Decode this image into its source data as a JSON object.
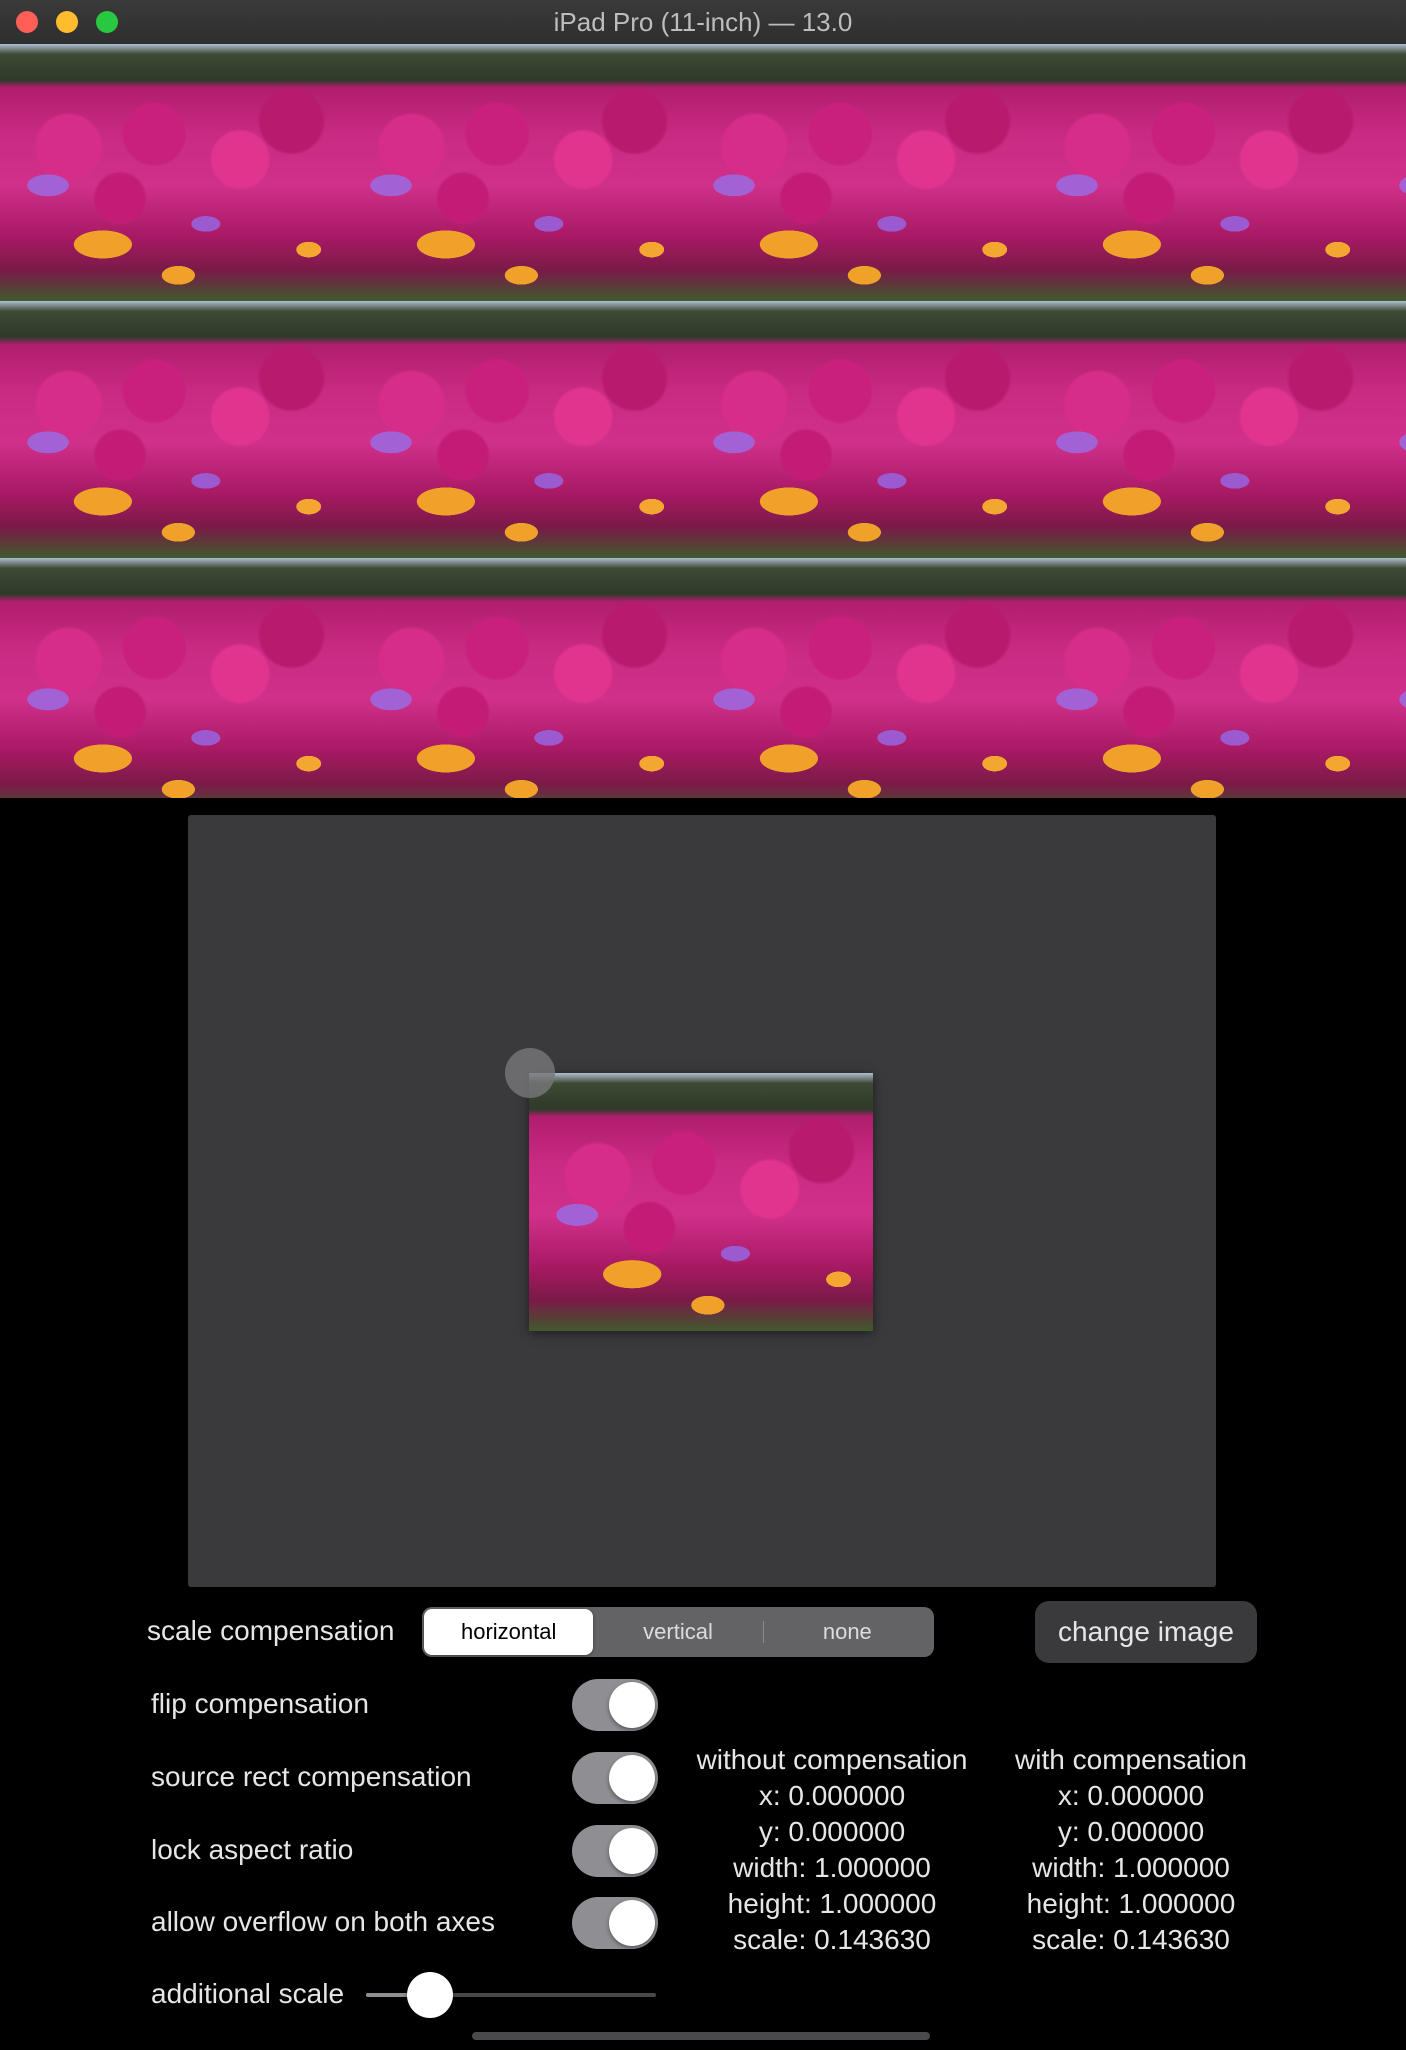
{
  "window": {
    "title": "iPad Pro (11-inch) — 13.0"
  },
  "controls": {
    "scale_compensation_label": "scale compensation",
    "segments": [
      "horizontal",
      "vertical",
      "none"
    ],
    "selected_segment": "horizontal",
    "change_image_label": "change image",
    "toggles": [
      {
        "label": "flip compensation",
        "on": true
      },
      {
        "label": "source rect compensation",
        "on": true
      },
      {
        "label": "lock aspect ratio",
        "on": true
      },
      {
        "label": "allow overflow on both axes",
        "on": true
      }
    ],
    "additional_scale_label": "additional scale",
    "additional_scale_value": 0.22
  },
  "results": {
    "without": {
      "heading": "without compensation",
      "x": "x: 0.000000",
      "y": "y: 0.000000",
      "width": "width: 1.000000",
      "height": "height: 1.000000",
      "scale": "scale: 0.143630"
    },
    "with": {
      "heading": "with compensation",
      "x": "x: 0.000000",
      "y": "y: 0.000000",
      "width": "width: 1.000000",
      "height": "height: 1.000000",
      "scale": "scale: 0.143630"
    }
  },
  "colors": {
    "background": "#000000",
    "panel": "#3a3a3c",
    "toggle_on": "#8e8e93"
  }
}
